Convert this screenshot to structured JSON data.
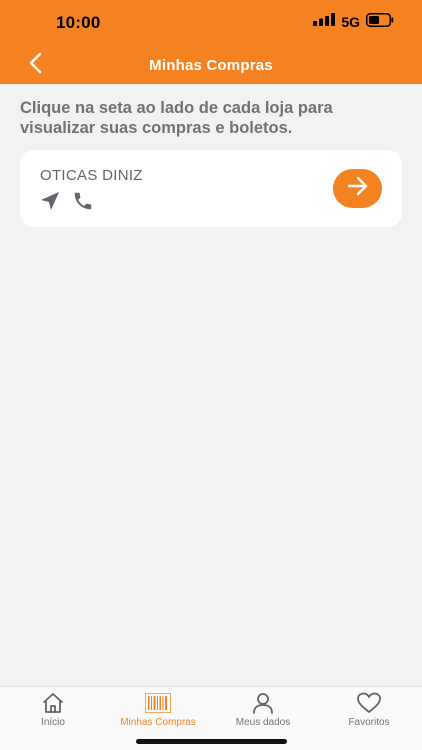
{
  "status_bar": {
    "time": "10:00",
    "network": "5G",
    "signal_icon": "signal-bars-icon",
    "battery_icon": "battery-icon"
  },
  "header": {
    "title": "Minhas Compras",
    "back_icon": "chevron-left-icon",
    "background_color": "#f58220"
  },
  "intro": {
    "text": "Clique na seta ao lado de cada loja para visualizar suas compras e boletos."
  },
  "stores": [
    {
      "name": "OTICAS DINIZ",
      "icons": [
        "navigation-arrow-icon",
        "phone-icon"
      ],
      "action_icon": "arrow-right-icon"
    }
  ],
  "tabbar": {
    "active_color": "#f58220",
    "items": [
      {
        "label": "Início",
        "icon": "home-icon",
        "active": false
      },
      {
        "label": "Minhas Compras",
        "icon": "barcode-icon",
        "active": true
      },
      {
        "label": "Meus dados",
        "icon": "user-icon",
        "active": false
      },
      {
        "label": "Favoritos",
        "icon": "heart-icon",
        "active": false
      }
    ]
  }
}
